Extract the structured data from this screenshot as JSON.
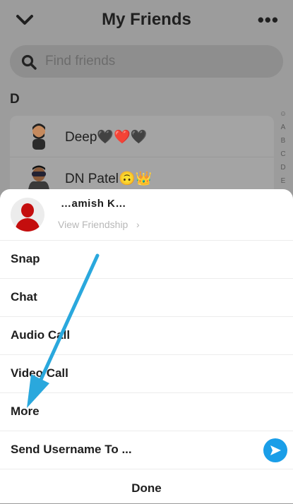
{
  "header": {
    "title": "My Friends"
  },
  "search": {
    "placeholder": "Find friends"
  },
  "section": {
    "letter": "D"
  },
  "friends": [
    {
      "name": "Deep🖤❤️🖤"
    },
    {
      "name": "DN Patel🙃👑"
    }
  ],
  "alpha_index": [
    "☺",
    "A",
    "B",
    "C",
    "D",
    "E"
  ],
  "sheet": {
    "profile_name": "…amish K…",
    "view_friendship": "View Friendship",
    "actions": [
      {
        "label": "Snap"
      },
      {
        "label": "Chat"
      },
      {
        "label": "Audio Call"
      },
      {
        "label": "Video Call"
      },
      {
        "label": "More"
      },
      {
        "label": "Send Username To ..."
      }
    ],
    "done": "Done"
  },
  "colors": {
    "accent_blue": "#1a9ee8",
    "overlay_arrow": "#2aa8dd",
    "bitmoji_red": "#c40e0e"
  }
}
